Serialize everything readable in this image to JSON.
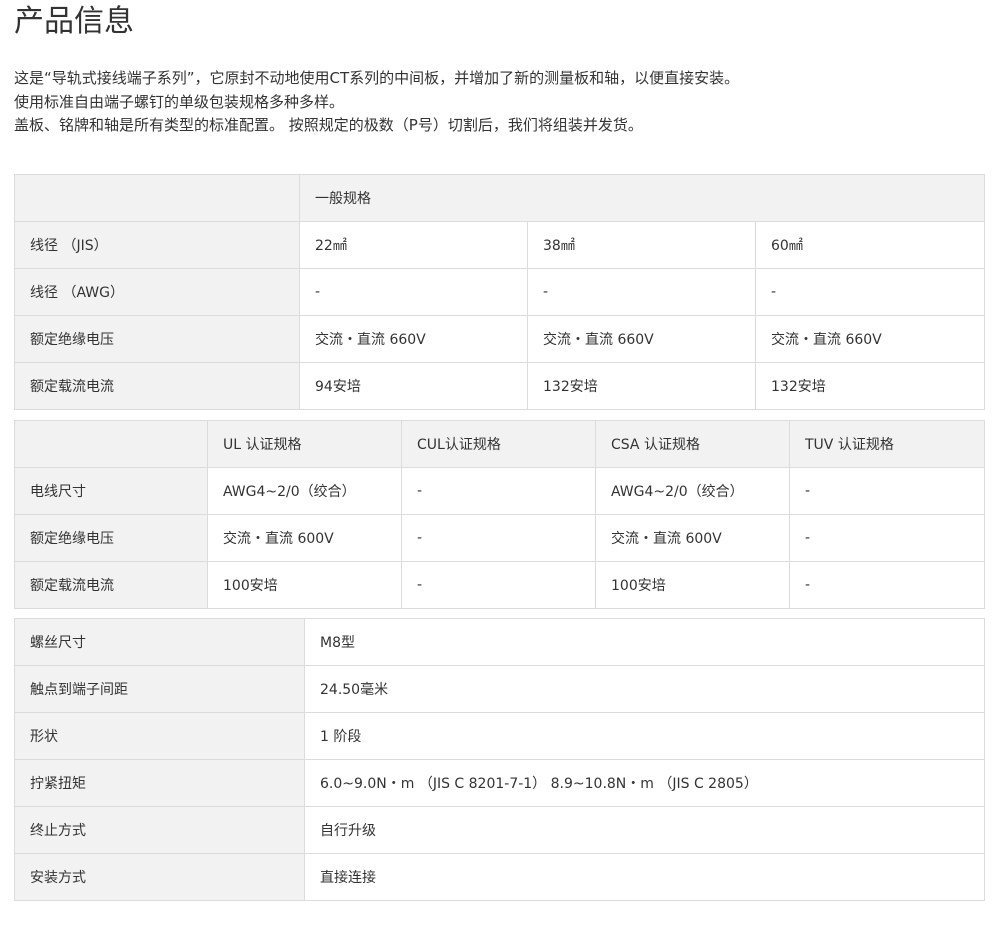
{
  "page": {
    "title": "产品信息"
  },
  "intro": [
    "这是“导轨式接线端子系列”，它原封不动地使用CT系列的中间板，并增加了新的测量板和轴，以便直接安装。",
    "使用标准自由端子螺钉的单级包装规格多种多样。",
    "盖板、铭牌和轴是所有类型的标准配置。 按照规定的极数（P号）切割后，我们将组装并发货。"
  ],
  "general_table": {
    "header": "一般规格",
    "rows": [
      {
        "label": "线径 （JIS）",
        "values": [
          "22㎟",
          "38㎟",
          "60㎟"
        ]
      },
      {
        "label": "线径 （AWG）",
        "values": [
          "-",
          "-",
          "-"
        ]
      },
      {
        "label": "额定绝缘电压",
        "values": [
          "交流・直流 660V",
          "交流・直流 660V",
          "交流・直流 660V"
        ]
      },
      {
        "label": "额定载流电流",
        "values": [
          "94安培",
          "132安培",
          "132安培"
        ]
      }
    ]
  },
  "cert_table": {
    "headers": [
      "UL 认证规格",
      "CUL认证规格",
      "CSA 认证规格",
      "TUV 认证规格"
    ],
    "rows": [
      {
        "label": "电线尺寸",
        "values": [
          "AWG4~2/0（绞合）",
          "-",
          "AWG4~2/0（绞合）",
          "-"
        ]
      },
      {
        "label": "额定绝缘电压",
        "values": [
          "交流・直流 600V",
          "-",
          "交流・直流 600V",
          "-"
        ]
      },
      {
        "label": "额定载流电流",
        "values": [
          "100安培",
          "-",
          "100安培",
          "-"
        ]
      }
    ]
  },
  "misc_table": {
    "rows": [
      {
        "label": "螺丝尺寸",
        "value": "M8型"
      },
      {
        "label": "触点到端子间距",
        "value": "24.50毫米"
      },
      {
        "label": "形状",
        "value": "1 阶段"
      },
      {
        "label": "拧紧扭矩",
        "value": "6.0~9.0N・m （JIS C 8201-7-1） 8.9~10.8N・m （JIS C 2805）"
      },
      {
        "label": "终止方式",
        "value": "自行升级"
      },
      {
        "label": "安装方式",
        "value": "直接连接"
      }
    ]
  }
}
